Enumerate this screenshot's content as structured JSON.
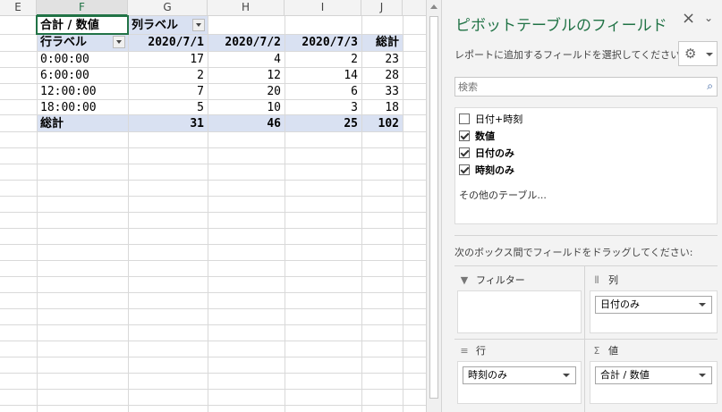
{
  "sheet": {
    "columns": [
      "E",
      "F",
      "G",
      "H",
      "I",
      "J"
    ],
    "active_column": "F",
    "pivot": {
      "value_label": "合計 / 数値",
      "col_label_caption": "列ラベル",
      "row_label_caption": "行ラベル",
      "col_headers": [
        "2020/7/1",
        "2020/7/2",
        "2020/7/3",
        "総計"
      ],
      "rows": [
        {
          "label": "0:00:00",
          "values": [
            "17",
            "4",
            "2",
            "23"
          ]
        },
        {
          "label": "6:00:00",
          "values": [
            "2",
            "12",
            "14",
            "28"
          ]
        },
        {
          "label": "12:00:00",
          "values": [
            "7",
            "20",
            "6",
            "33"
          ]
        },
        {
          "label": "18:00:00",
          "values": [
            "5",
            "10",
            "3",
            "18"
          ]
        }
      ],
      "total": {
        "label": "総計",
        "values": [
          "31",
          "46",
          "25",
          "102"
        ]
      }
    }
  },
  "pane": {
    "title": "ピボットテーブルのフィールド",
    "close_glyph": "×",
    "chevron_glyph": "⌄",
    "instruction": "レポートに追加するフィールドを選択してください:",
    "gear_glyph": "⚙",
    "search_placeholder": "検索",
    "search_glyph": "⌕",
    "fields": [
      {
        "label": "日付+時刻",
        "checked": false
      },
      {
        "label": "数値",
        "checked": true
      },
      {
        "label": "日付のみ",
        "checked": true
      },
      {
        "label": "時刻のみ",
        "checked": true
      }
    ],
    "more_tables": "その他のテーブル...",
    "areas_instruction": "次のボックス間でフィールドをドラッグしてください:",
    "areas": {
      "filter": {
        "label": "フィルター",
        "icon": "▼",
        "item": ""
      },
      "columns": {
        "label": "列",
        "icon": "⦀",
        "item": "日付のみ"
      },
      "rows": {
        "label": "行",
        "icon": "≡",
        "item": "時刻のみ"
      },
      "values": {
        "label": "値",
        "icon": "Σ",
        "item": "合計 / 数値"
      }
    }
  }
}
